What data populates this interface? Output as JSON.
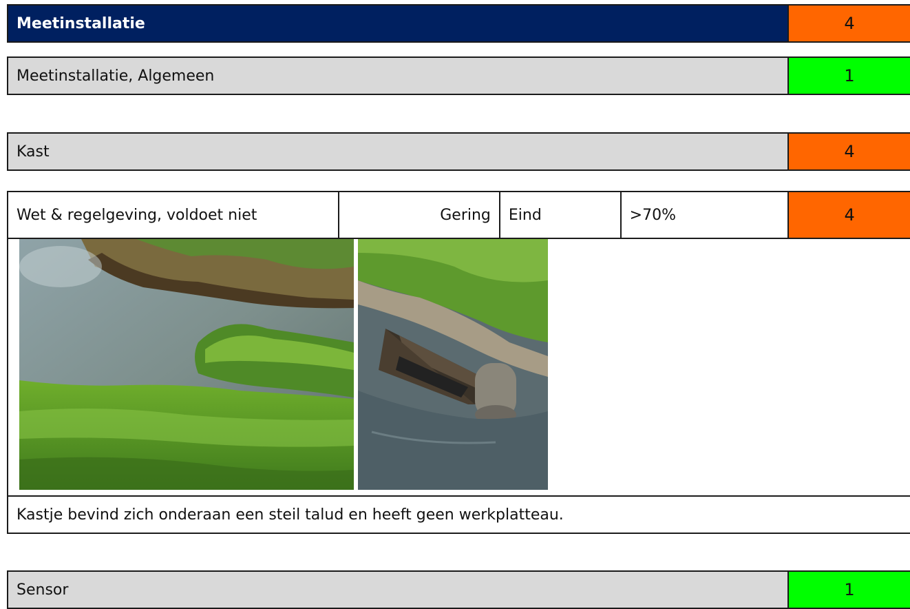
{
  "colors": {
    "header_bg": "#002060",
    "subheader_bg": "#d9d9d9",
    "score_orange": "#ff6600",
    "score_green": "#00ff00"
  },
  "header": {
    "label": "Meetinstallatie",
    "score": "4",
    "score_color": "#ff6600"
  },
  "sections": [
    {
      "label": "Meetinstallatie, Algemeen",
      "score": "1",
      "score_color": "#00ff00"
    },
    {
      "label": "Kast",
      "score": "4",
      "score_color": "#ff6600"
    }
  ],
  "finding": {
    "description": "Wet & regelgeving, voldoet niet",
    "severity": "Gering",
    "phase": "Eind",
    "percentage": ">70%",
    "score": "4",
    "score_color": "#ff6600",
    "photos": [
      {
        "icon": "photo-ditch-bank"
      },
      {
        "icon": "photo-measurement-box"
      }
    ],
    "note": "Kastje bevind zich onderaan een steil talud en heeft geen werkplatteau."
  },
  "next_section": {
    "label": "Sensor",
    "score": "1",
    "score_color": "#00ff00"
  }
}
